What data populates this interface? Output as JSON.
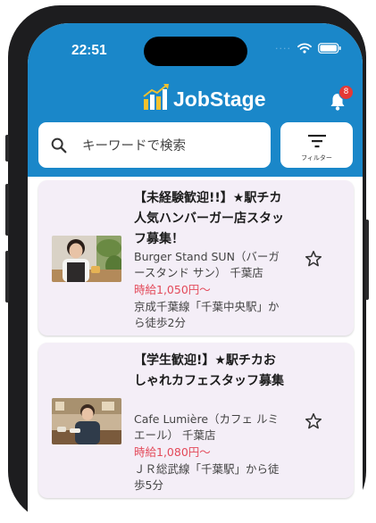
{
  "status_bar": {
    "time": "22:51",
    "signal_dots": "····"
  },
  "header": {
    "logo_text": "JobStage",
    "notification_count": "8",
    "search": {
      "placeholder": "キーワードで検索"
    },
    "filter_label": "フィルター"
  },
  "jobs": [
    {
      "title": "【未経験歓迎!!】★駅チカ人気ハンバーガー店スタッフ募集！",
      "employer": "Burger Stand SUN（バーガースタンド サン） 千葉店",
      "wage": "時給1,050円～",
      "access": "京成千葉線「千葉中央駅」から徒歩2分"
    },
    {
      "title": "【学生歓迎!】★駅チカおしゃれカフェスタッフ募集",
      "employer": "Cafe Lumière（カフェ ルミエール） 千葉店",
      "wage": "時給1,080円～",
      "access": "ＪＲ総武線「千葉駅」から徒歩5分"
    }
  ],
  "colors": {
    "header_bg": "#1a87c9",
    "card_bg": "#f4eef7",
    "wage": "#e34a5a",
    "badge": "#e53935"
  },
  "icons": [
    "search-icon",
    "filter-icon",
    "bell-icon",
    "star-outline-icon",
    "wifi-icon",
    "battery-icon",
    "logo-chart-icon"
  ]
}
